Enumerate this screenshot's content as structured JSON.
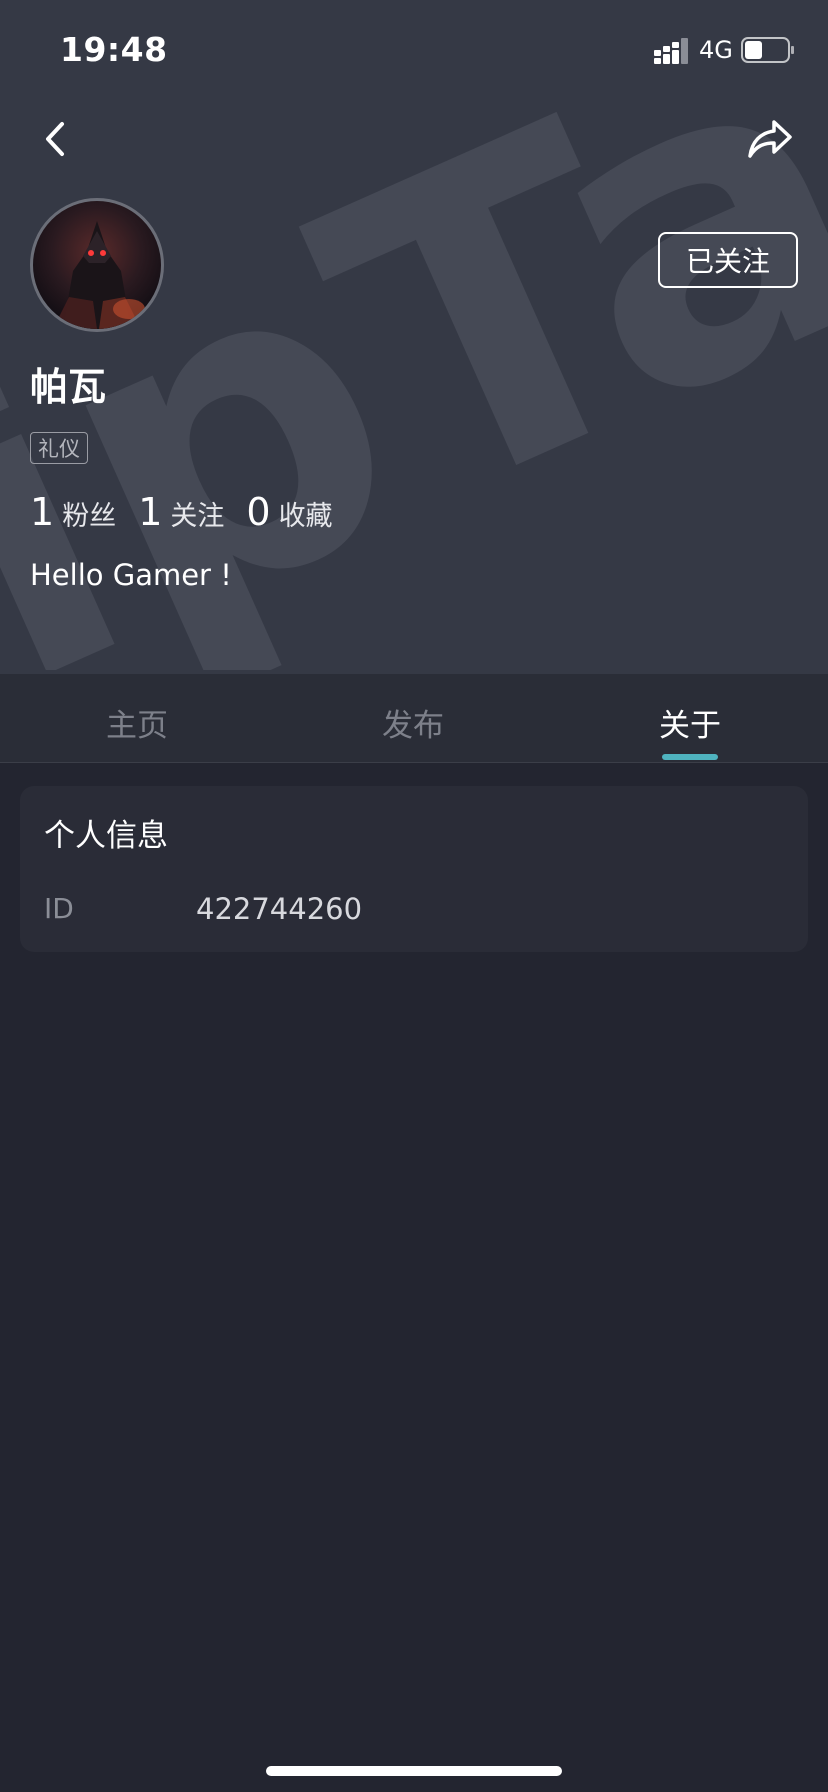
{
  "status_bar": {
    "time": "19:48",
    "network": "4G",
    "battery_fraction": 0.35
  },
  "nav": {
    "back_icon": "chevron-left-icon",
    "share_icon": "share-icon"
  },
  "profile": {
    "name": "帕瓦",
    "tag": "礼仪",
    "follow_label": "已关注",
    "stats": [
      {
        "value": "1",
        "label": "粉丝"
      },
      {
        "value": "1",
        "label": "关注"
      },
      {
        "value": "0",
        "label": "收藏"
      }
    ],
    "bio": "Hello Gamer !",
    "watermark": "TapTap"
  },
  "tabs": [
    {
      "label": "主页",
      "active": false
    },
    {
      "label": "发布",
      "active": false
    },
    {
      "label": "关于",
      "active": true
    }
  ],
  "info_card": {
    "title": "个人信息",
    "fields": [
      {
        "label": "ID",
        "value": "422744260"
      }
    ]
  },
  "colors": {
    "header_bg": "#353945",
    "page_bg": "#232530",
    "accent": "#4fb3bf"
  }
}
